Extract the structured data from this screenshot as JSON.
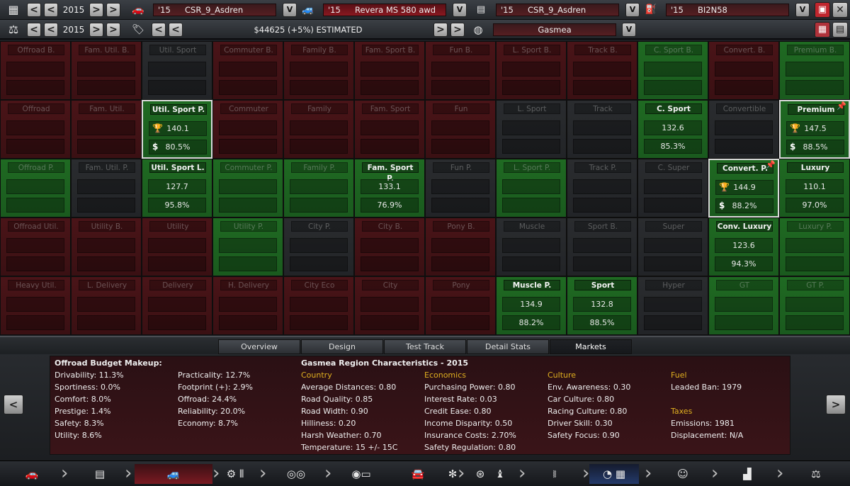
{
  "toolbar": {
    "year1": "2015",
    "year2": "2015",
    "slot1": {
      "prefix": "'15",
      "name": "CSR_9_Asdren"
    },
    "slot2": {
      "prefix": "'15",
      "name": "Revera MS 580 awd"
    },
    "slot3": {
      "prefix": "'15",
      "name": "CSR_9_Asdren"
    },
    "slot4": {
      "prefix": "'15",
      "name": "BI2N58"
    },
    "estimate": "$44625 (+5%) ESTIMATED",
    "region": "Gasmea",
    "v": "V",
    "back": "<",
    "fwd": ">"
  },
  "grid": [
    [
      {
        "t": "Offroad B.",
        "s": "r"
      },
      {
        "t": "Fam. Util. B.",
        "s": "r"
      },
      {
        "t": "Util. Sport",
        "s": "d"
      },
      {
        "t": "Commuter B.",
        "s": "r"
      },
      {
        "t": "Family B.",
        "s": "r"
      },
      {
        "t": "Fam. Sport B.",
        "s": "r"
      },
      {
        "t": "Fun B.",
        "s": "r"
      },
      {
        "t": "L. Sport B.",
        "s": "r"
      },
      {
        "t": "Track B.",
        "s": "r"
      },
      {
        "t": "C. Sport B.",
        "s": "g"
      },
      {
        "t": "Convert. B.",
        "s": "r"
      },
      {
        "t": "Premium B.",
        "s": "g"
      }
    ],
    [
      {
        "t": "Offroad",
        "s": "r"
      },
      {
        "t": "Fam. Util.",
        "s": "r"
      },
      {
        "t": "Util. Sport P.",
        "s": "g",
        "on": true,
        "v1": "140.1",
        "v2": "80.5%",
        "sel": true
      },
      {
        "t": "Commuter",
        "s": "r"
      },
      {
        "t": "Family",
        "s": "r"
      },
      {
        "t": "Fam. Sport",
        "s": "r"
      },
      {
        "t": "Fun",
        "s": "r"
      },
      {
        "t": "L. Sport",
        "s": "d"
      },
      {
        "t": "Track",
        "s": "d"
      },
      {
        "t": "C. Sport",
        "s": "g",
        "on": true,
        "v1": "132.6",
        "v2": "85.3%"
      },
      {
        "t": "Convertible",
        "s": "d"
      },
      {
        "t": "Premium",
        "s": "g",
        "on": true,
        "v1": "147.5",
        "v2": "88.5%",
        "sel": true,
        "pin": true
      }
    ],
    [
      {
        "t": "Offroad P.",
        "s": "g"
      },
      {
        "t": "Fam. Util. P.",
        "s": "d"
      },
      {
        "t": "Util. Sport L.",
        "s": "g",
        "on": true,
        "v1": "127.7",
        "v2": "95.8%"
      },
      {
        "t": "Commuter P.",
        "s": "g"
      },
      {
        "t": "Family P.",
        "s": "g"
      },
      {
        "t": "Fam. Sport P.",
        "s": "g",
        "on": true,
        "v1": "133.1",
        "v2": "76.9%"
      },
      {
        "t": "Fun P.",
        "s": "d"
      },
      {
        "t": "L. Sport P.",
        "s": "g"
      },
      {
        "t": "Track P.",
        "s": "d"
      },
      {
        "t": "C. Super",
        "s": "d"
      },
      {
        "t": "Convert. P.",
        "s": "g",
        "on": true,
        "v1": "144.9",
        "v2": "88.2%",
        "sel": true,
        "pin": true
      },
      {
        "t": "Luxury",
        "s": "g",
        "on": true,
        "v1": "110.1",
        "v2": "97.0%"
      }
    ],
    [
      {
        "t": "Offroad Util.",
        "s": "r"
      },
      {
        "t": "Utility B.",
        "s": "r"
      },
      {
        "t": "Utility",
        "s": "r"
      },
      {
        "t": "Utility P.",
        "s": "g"
      },
      {
        "t": "City P.",
        "s": "d"
      },
      {
        "t": "City B.",
        "s": "r"
      },
      {
        "t": "Pony B.",
        "s": "r"
      },
      {
        "t": "Muscle",
        "s": "d"
      },
      {
        "t": "Sport B.",
        "s": "d"
      },
      {
        "t": "Super",
        "s": "d"
      },
      {
        "t": "Conv. Luxury",
        "s": "g",
        "on": true,
        "v1": "123.6",
        "v2": "94.3%"
      },
      {
        "t": "Luxury P.",
        "s": "g"
      }
    ],
    [
      {
        "t": "Heavy Util.",
        "s": "r"
      },
      {
        "t": "L. Delivery",
        "s": "r"
      },
      {
        "t": "Delivery",
        "s": "r"
      },
      {
        "t": "H. Delivery",
        "s": "r"
      },
      {
        "t": "City Eco",
        "s": "r"
      },
      {
        "t": "City",
        "s": "r"
      },
      {
        "t": "Pony",
        "s": "r"
      },
      {
        "t": "Muscle P.",
        "s": "g",
        "on": true,
        "v1": "134.9",
        "v2": "88.2%"
      },
      {
        "t": "Sport",
        "s": "g",
        "on": true,
        "v1": "132.8",
        "v2": "88.5%"
      },
      {
        "t": "Hyper",
        "s": "d"
      },
      {
        "t": "GT",
        "s": "g"
      },
      {
        "t": "GT P.",
        "s": "g"
      }
    ]
  ],
  "tabs": [
    "Overview",
    "Design",
    "Test Track",
    "Detail Stats",
    "Markets"
  ],
  "info": {
    "budget_title": "Offroad Budget Makeup:",
    "col1": [
      "Drivability: 11.3%",
      "Sportiness: 0.0%",
      "Comfort: 8.0%",
      "Prestige: 1.4%",
      "Safety: 8.3%",
      "Utility: 8.6%"
    ],
    "col2": [
      "Practicality: 12.7%",
      "Footprint (+): 2.9%",
      "Offroad: 24.4%",
      "Reliability: 20.0%",
      "Economy: 8.7%"
    ],
    "region_title": "Gasmea Region Characteristics - 2015",
    "country_h": "Country",
    "country": [
      "Average Distances: 0.80",
      "Road Quality: 0.85",
      "Road Width: 0.90",
      "Hilliness: 0.20",
      "Harsh Weather: 0.70",
      "Temperature: 15 +/- 15C"
    ],
    "economics_h": "Economics",
    "economics": [
      "Purchasing Power: 0.80",
      "Interest Rate: 0.03",
      "Credit Ease: 0.80",
      "Income Disparity: 0.50",
      "Insurance Costs: 2.70%",
      "Safety Regulation: 0.80"
    ],
    "culture_h": "Culture",
    "culture": [
      "Env. Awareness: 0.30",
      "Car Culture: 0.80",
      "Racing Culture: 0.80",
      "Driver Skill: 0.30",
      "Safety Focus: 0.90"
    ],
    "fuel_h": "Fuel",
    "fuel": [
      "Leaded Ban: 1979"
    ],
    "taxes_h": "Taxes",
    "taxes": [
      "Emissions: 1981",
      "Displacement: N/A"
    ]
  }
}
